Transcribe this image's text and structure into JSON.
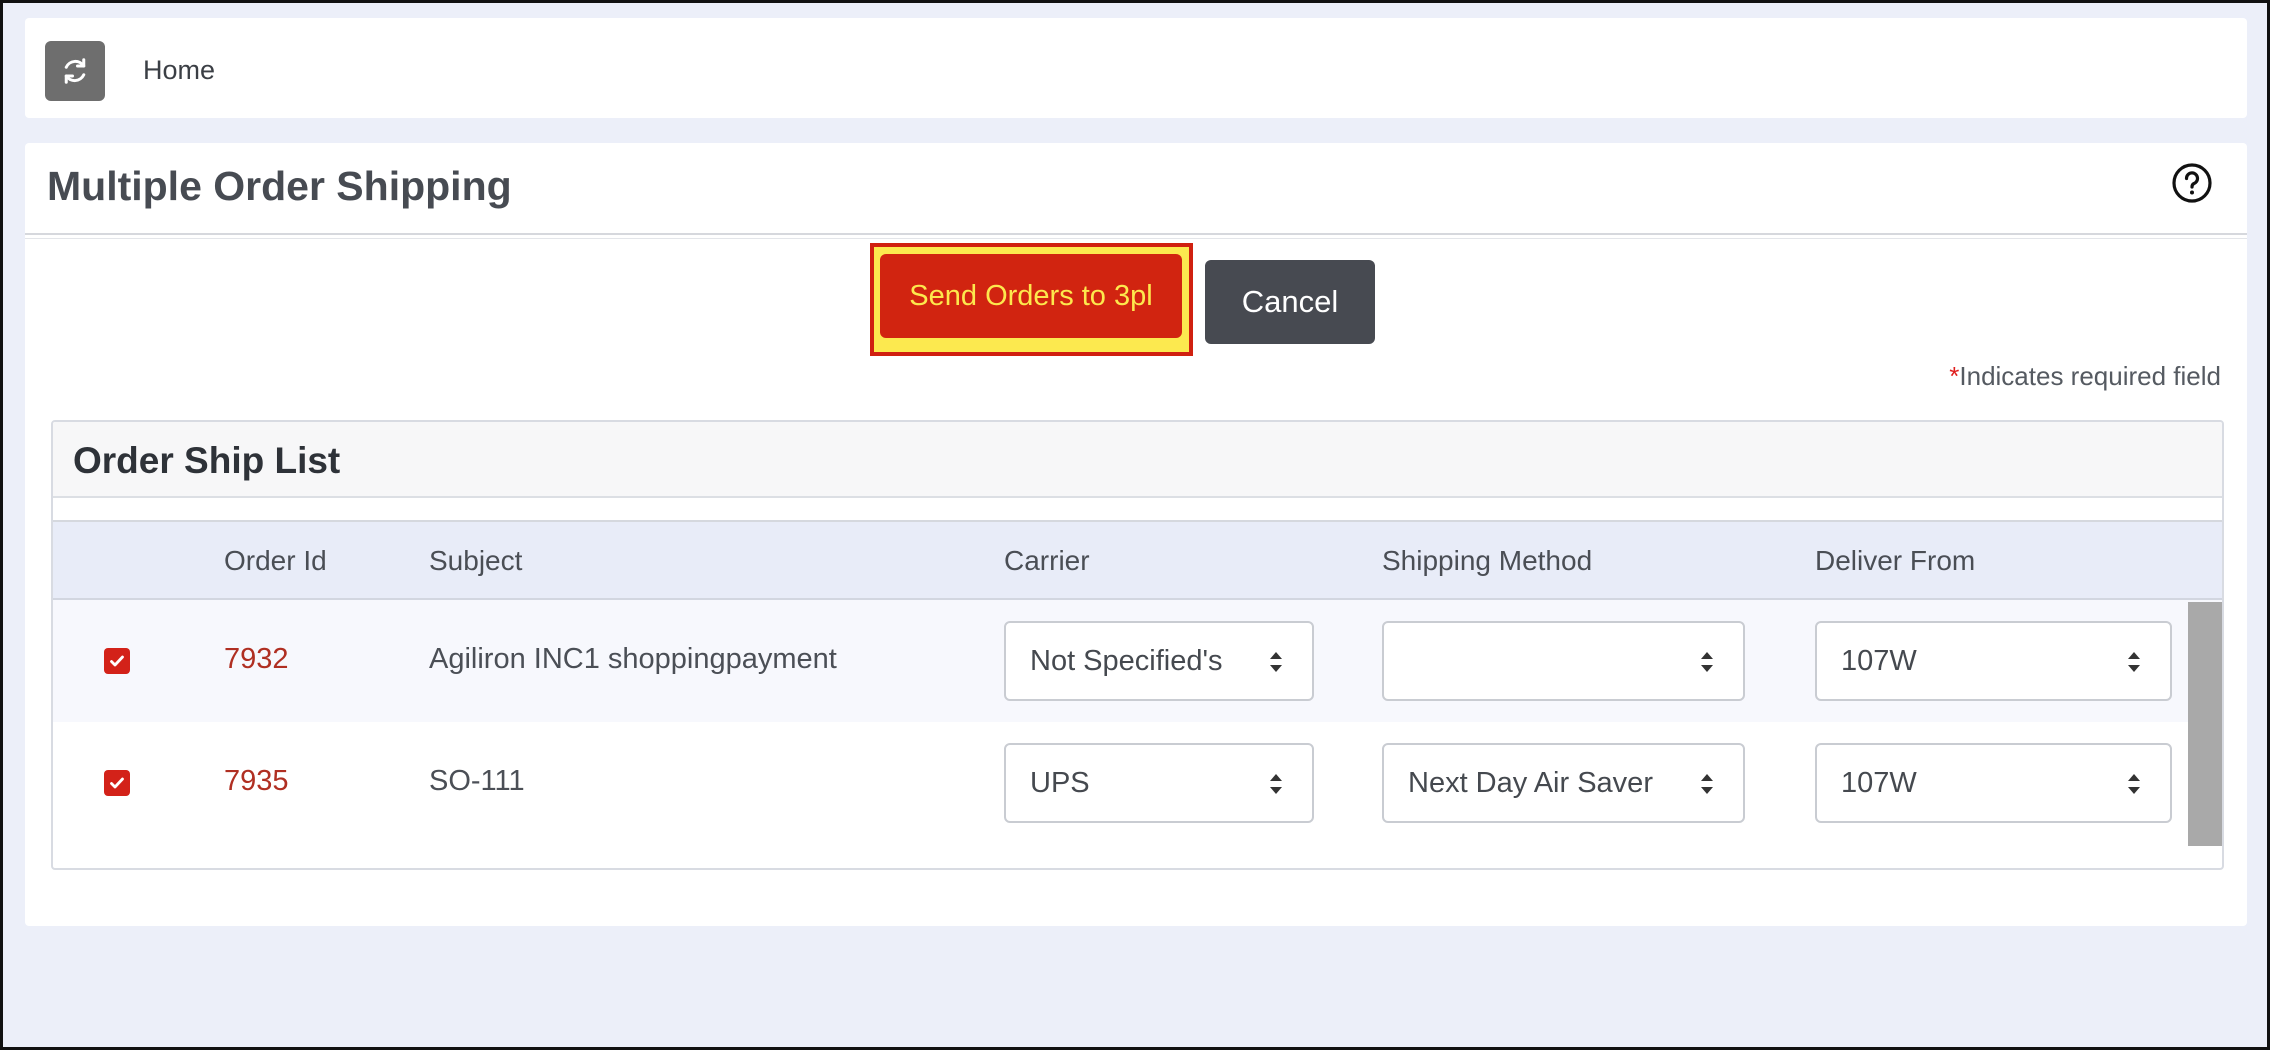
{
  "topbar": {
    "refresh_icon": "refresh-icon",
    "home_label": "Home"
  },
  "page": {
    "title": "Multiple Order Shipping",
    "help_icon": "question-circle-icon"
  },
  "actions": {
    "send_label": "Send Orders to 3pl",
    "cancel_label": "Cancel"
  },
  "required_note": {
    "star": "*",
    "text": "Indicates required field"
  },
  "order_list": {
    "title": "Order Ship List",
    "columns": [
      "",
      "Order Id",
      "Subject",
      "Carrier",
      "Shipping Method",
      "Deliver From"
    ],
    "rows": [
      {
        "checked": true,
        "order_id": "7932",
        "subject": "Agiliron INC1 shoppingpayment",
        "carrier": "Not Specified's",
        "shipping_method": "",
        "deliver_from": "107W"
      },
      {
        "checked": true,
        "order_id": "7935",
        "subject": "SO-111",
        "carrier": "UPS",
        "shipping_method": "Next Day Air Saver",
        "deliver_from": "107W"
      }
    ]
  },
  "colors": {
    "accent_red": "#d12410",
    "highlight_yellow": "#fce94f",
    "order_id_color": "#b02f22",
    "cancel_bg": "#474a51"
  }
}
